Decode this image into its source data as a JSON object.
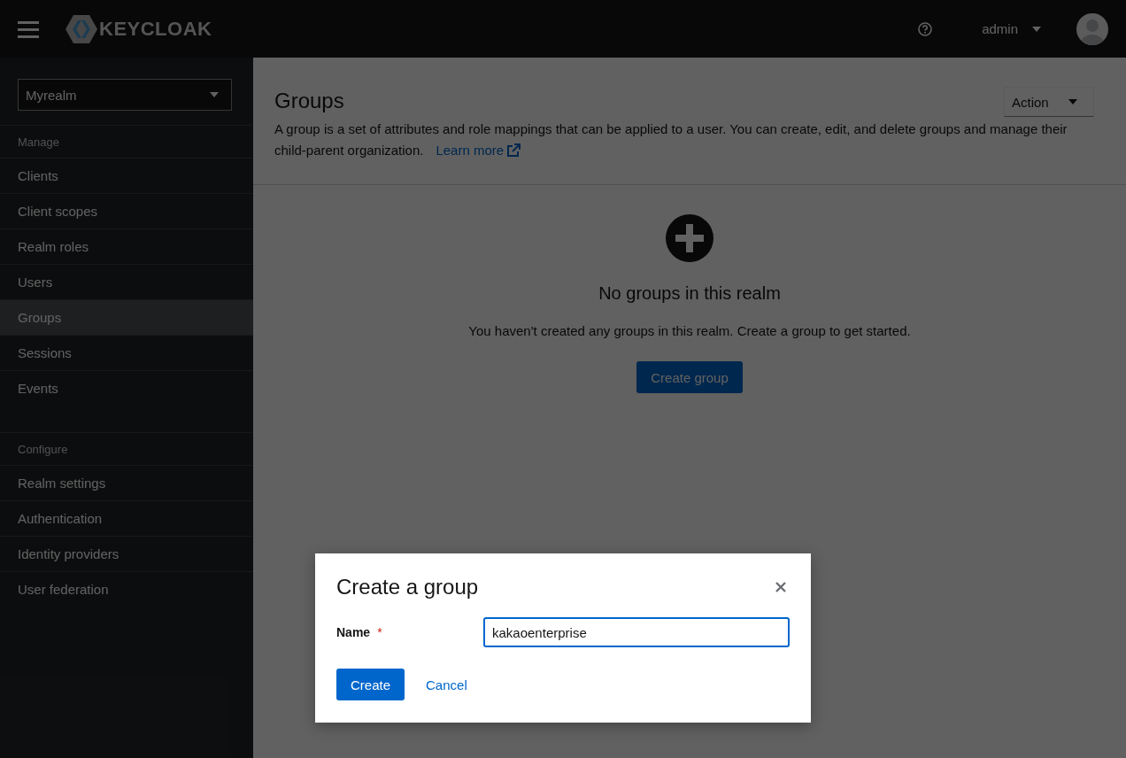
{
  "masthead": {
    "logo_text": "KEYCLOAK",
    "user": "admin"
  },
  "sidebar": {
    "realm": "Myrealm",
    "sections": [
      {
        "title": "Manage",
        "items": [
          {
            "label": "Clients",
            "selected": false
          },
          {
            "label": "Client scopes",
            "selected": false
          },
          {
            "label": "Realm roles",
            "selected": false
          },
          {
            "label": "Users",
            "selected": false
          },
          {
            "label": "Groups",
            "selected": true
          },
          {
            "label": "Sessions",
            "selected": false
          },
          {
            "label": "Events",
            "selected": false
          }
        ]
      },
      {
        "title": "Configure",
        "items": [
          {
            "label": "Realm settings",
            "selected": false
          },
          {
            "label": "Authentication",
            "selected": false
          },
          {
            "label": "Identity providers",
            "selected": false
          },
          {
            "label": "User federation",
            "selected": false
          }
        ]
      }
    ]
  },
  "page": {
    "title": "Groups",
    "description": "A group is a set of attributes and role mappings that can be applied to a user. You can create, edit, and delete groups and manage their child-parent organization.",
    "learn_more": "Learn more",
    "action": "Action"
  },
  "empty_state": {
    "title": "No groups in this realm",
    "body": "You haven't created any groups in this realm. Create a group to get started.",
    "button": "Create group"
  },
  "modal": {
    "title": "Create a group",
    "field_label": "Name",
    "required": true,
    "required_mark": "*",
    "value": "kakaoenterprise",
    "primary": "Create",
    "secondary": "Cancel"
  }
}
